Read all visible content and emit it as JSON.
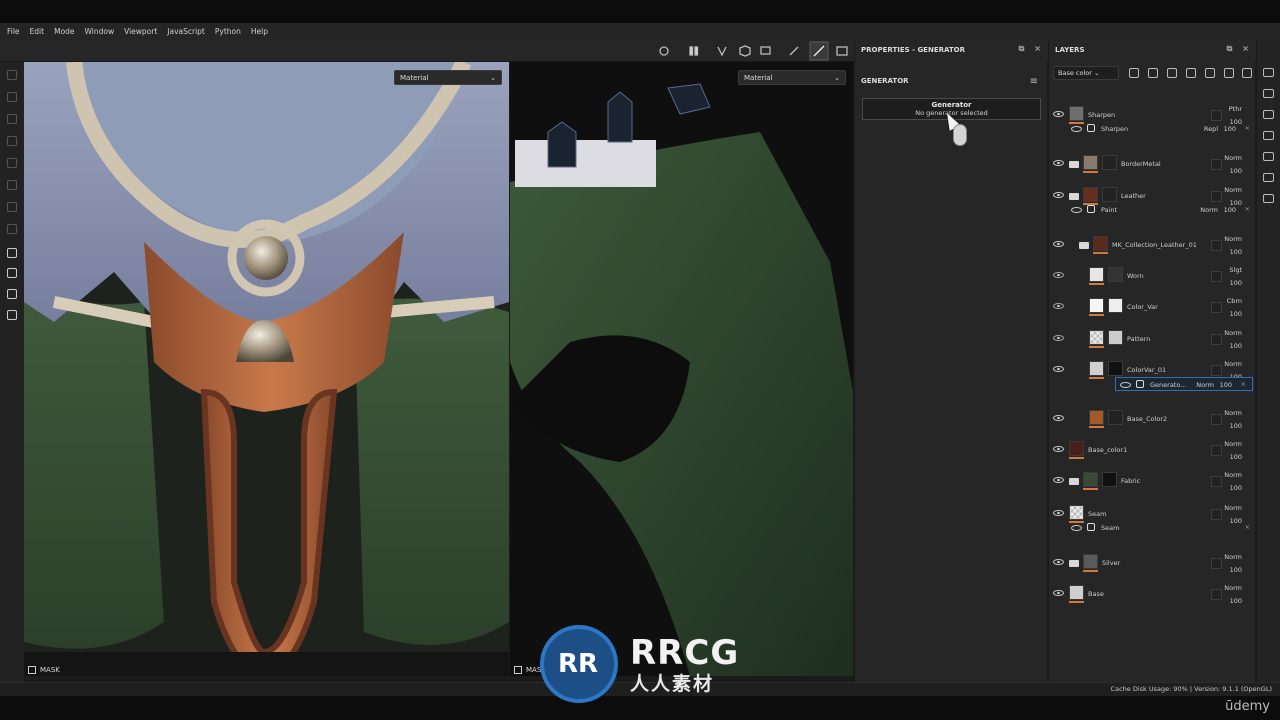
{
  "menu": [
    "File",
    "Edit",
    "Mode",
    "Window",
    "Viewport",
    "JavaScript",
    "Python",
    "Help"
  ],
  "viewport": {
    "left_material": "Material",
    "right_material": "Material",
    "mask_label": "MASK",
    "mask_label_right": "MAS"
  },
  "properties": {
    "header": "PROPERTIES - GENERATOR",
    "section": "GENERATOR",
    "box_title": "Generator",
    "box_subtitle": "No generator selected"
  },
  "layers": {
    "header": "LAYERS",
    "blend_mode": "Base color",
    "rows": [
      {
        "name": "Sharpen",
        "blend": "Pthr",
        "opacity": "100"
      },
      {
        "name": "BorderMetal",
        "blend": "Norm",
        "opacity": "100"
      },
      {
        "name": "Leather",
        "blend": "Norm",
        "opacity": "100"
      },
      {
        "name": "MK_Collection_Leather_01",
        "blend": "Norm",
        "opacity": "100"
      },
      {
        "name": "Worn",
        "blend": "Slgt",
        "opacity": "100"
      },
      {
        "name": "Color_Var",
        "blend": "Cbrn",
        "opacity": "100"
      },
      {
        "name": "Pattern",
        "blend": "Norm",
        "opacity": "100"
      },
      {
        "name": "ColorVar_01",
        "blend": "Norm",
        "opacity": "100"
      },
      {
        "name": "Base_Color2",
        "blend": "Norm",
        "opacity": "100"
      },
      {
        "name": "Base_color1",
        "blend": "Norm",
        "opacity": "100"
      },
      {
        "name": "Fabric",
        "blend": "Norm",
        "opacity": "100"
      },
      {
        "name": "Seam",
        "blend": "Norm",
        "opacity": "100"
      },
      {
        "name": "Silver",
        "blend": "Norm",
        "opacity": "100"
      },
      {
        "name": "Base",
        "blend": "Norm",
        "opacity": "100"
      }
    ],
    "subrows": [
      {
        "name": "Sharpen",
        "blend": "Repl",
        "opacity": "100"
      },
      {
        "name": "Paint",
        "blend": "Norm",
        "opacity": "100"
      },
      {
        "name": "Generato...",
        "blend": "Norm",
        "opacity": "100"
      },
      {
        "name": "Seam",
        "blend": "",
        "opacity": ""
      }
    ]
  },
  "status": {
    "cache": "Cache Disk Usage:  90% | Version: 9.1.1 (OpenGL)"
  },
  "watermark": {
    "line1": "RRCG",
    "line2": "人人素材",
    "logo": "RR"
  },
  "brand": "ūdemy",
  "colors": {
    "accent_orange": "#d07a3c",
    "selection_blue": "#2f6fb6"
  }
}
